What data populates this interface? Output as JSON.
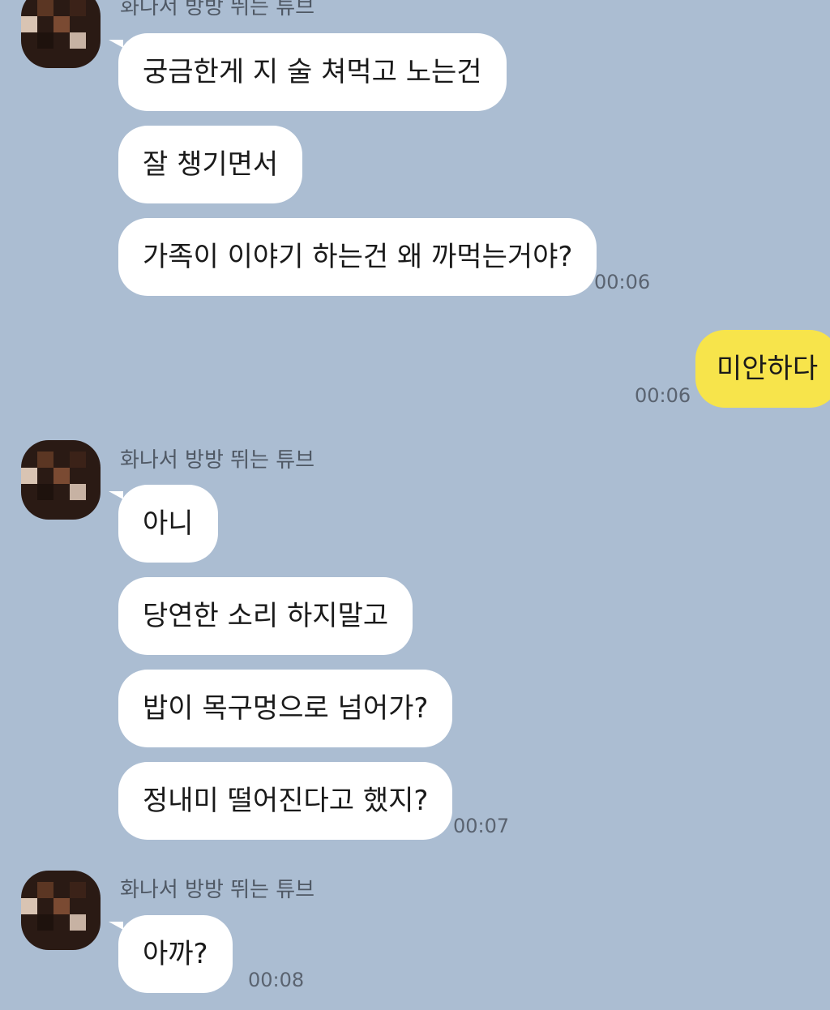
{
  "groups": [
    {
      "sender": "화나서 방방 뛰는 튜브",
      "messages": [
        "궁금한게 지 술 쳐먹고 노는건",
        "잘 챙기면서",
        "가족이 이야기 하는건 왜 까먹는거야?"
      ],
      "time": "00:06"
    },
    {
      "sender": "me",
      "messages": [
        "미안하다"
      ],
      "time": "00:06"
    },
    {
      "sender": "화나서 방방 뛰는 튜브",
      "messages": [
        "아니",
        "당연한 소리 하지말고",
        "밥이 목구멍으로 넘어가?",
        "정내미 떨어진다고 했지?"
      ],
      "time": "00:07"
    },
    {
      "sender": "화나서 방방 뛰는 튜브",
      "messages": [
        "아까?"
      ],
      "time": "00:08"
    }
  ],
  "colors": {
    "background": "#abbdd2",
    "incoming_bubble": "#ffffff",
    "outgoing_bubble": "#f7e44b",
    "timestamp": "#5a6370",
    "sender_name": "#4f5864"
  },
  "icons": {
    "avatar": "pixelated-profile-avatar"
  }
}
